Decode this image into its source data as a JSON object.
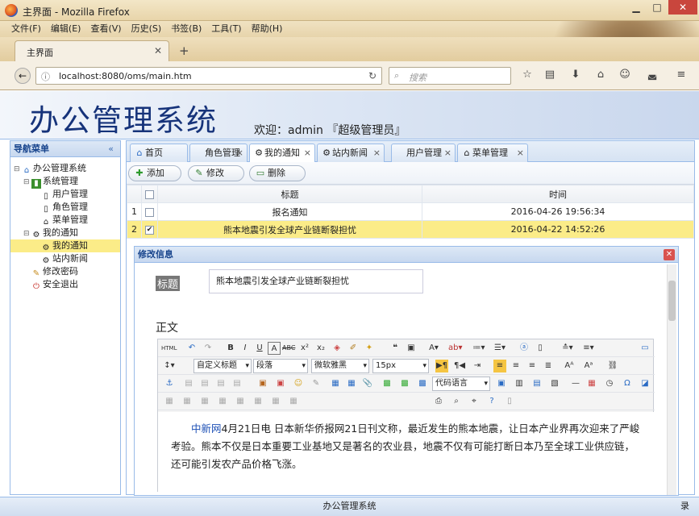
{
  "browser": {
    "window_title": "主界面 - Mozilla Firefox",
    "menu": [
      "文件(F)",
      "编辑(E)",
      "查看(V)",
      "历史(S)",
      "书签(B)",
      "工具(T)",
      "帮助(H)"
    ],
    "tab_title": "主界面",
    "url": "localhost:8080/oms/main.htm",
    "search_placeholder": "搜索"
  },
  "app": {
    "logo": "办公管理系统",
    "welcome": "欢迎：admin 『超级管理员』"
  },
  "sidebar": {
    "title": "导航菜单",
    "collapse": "«",
    "nodes": [
      {
        "label": "办公管理系统",
        "level": 0
      },
      {
        "label": "系统管理",
        "level": 1
      },
      {
        "label": "用户管理",
        "level": 2
      },
      {
        "label": "角色管理",
        "level": 2
      },
      {
        "label": "菜单管理",
        "level": 2
      },
      {
        "label": "我的通知",
        "level": 1
      },
      {
        "label": "我的通知",
        "level": 2,
        "selected": true
      },
      {
        "label": "站内新闻",
        "level": 2
      },
      {
        "label": "修改密码",
        "level": 1
      },
      {
        "label": "安全退出",
        "level": 1
      }
    ]
  },
  "tabs": [
    "首页",
    "角色管理",
    "我的通知",
    "站内新闻",
    "用户管理",
    "菜单管理"
  ],
  "toolbar": {
    "add": "添加",
    "edit": "修改",
    "delete": "删除"
  },
  "grid": {
    "headers": [
      "标题",
      "时间"
    ],
    "rows": [
      {
        "num": "1",
        "title": "报名通知",
        "time": "2016-04-26 19:56:34",
        "checked": false
      },
      {
        "num": "2",
        "title": "熊本地震引发全球产业链断裂担忧",
        "time": "2016-04-22 14:52:26",
        "checked": true
      }
    ]
  },
  "dialog": {
    "title": "修改信息",
    "title_label": "标题",
    "title_value": "熊本地震引发全球产业链断裂担忧",
    "content_label": "正文",
    "selects": {
      "style": "自定义标题",
      "para": "段落",
      "font": "微软雅黑",
      "size": "15px",
      "code": "代码语言"
    },
    "content_link": "中新网",
    "content_text": "4月21日电 日本新华侨报网21日刊文称，最近发生的熊本地震，让日本产业界再次迎来了严峻考验。熊本不仅是日本重要工业基地又是著名的农业县，地震不仅有可能打断日本乃至全球工业供应链，还可能引发农产品价格飞涨。"
  },
  "footer": {
    "text": "办公管理系统",
    "right": "录"
  }
}
